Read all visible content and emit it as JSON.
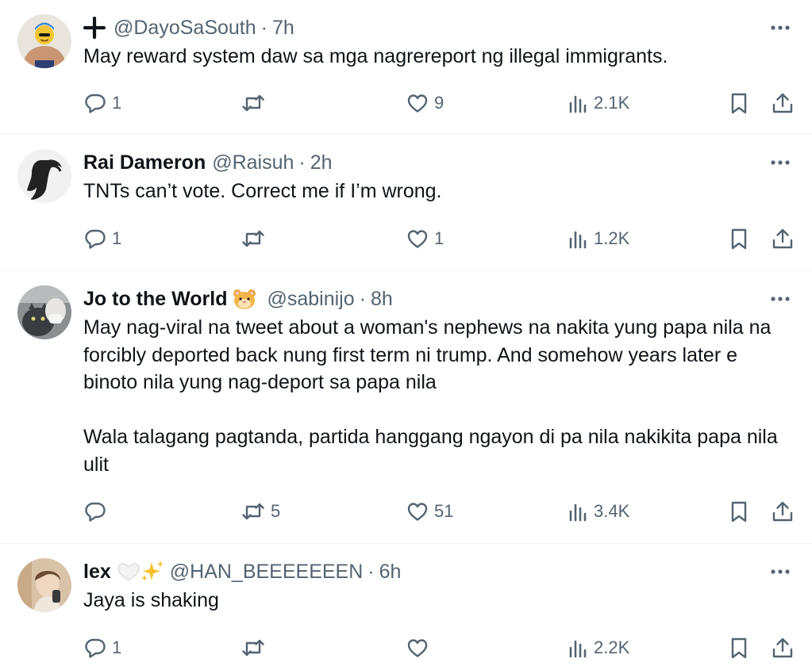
{
  "colors": {
    "text": "#0f1419",
    "muted": "#536471",
    "divider": "#eff3f4"
  },
  "tweets": [
    {
      "name": "",
      "name_icon": "plus-icon",
      "handle": "@DayoSaSouth",
      "time": "7h",
      "text": "May reward system daw sa mga nagrereport ng illegal immigrants.",
      "replies": "1",
      "retweets": "",
      "likes": "9",
      "views": "2.1K"
    },
    {
      "name": "Rai Dameron",
      "handle": "@Raisuh",
      "time": "2h",
      "text": "TNTs can’t vote. Correct me if I’m wrong.",
      "replies": "1",
      "retweets": "",
      "likes": "1",
      "views": "1.2K"
    },
    {
      "name": "Jo to the World",
      "name_emoji": "hamster-emoji",
      "handle": "@sabinijo",
      "time": "8h",
      "text": "May nag-viral na tweet about a woman's nephews na nakita yung papa nila na forcibly deported back nung first term ni trump. And somehow years later e binoto nila yung nag-deport sa papa nila\n\nWala talagang pagtanda, partida hanggang ngayon di pa nila nakikita papa nila ulit",
      "replies": "",
      "retweets": "5",
      "likes": "51",
      "views": "3.4K"
    },
    {
      "name": "lex",
      "name_emoji": "white-heart-sparkles-emoji",
      "handle": "@HAN_BEEEEEEEN",
      "time": "6h",
      "text": "Jaya is shaking",
      "replies": "1",
      "retweets": "",
      "likes": "",
      "views": "2.2K"
    }
  ]
}
